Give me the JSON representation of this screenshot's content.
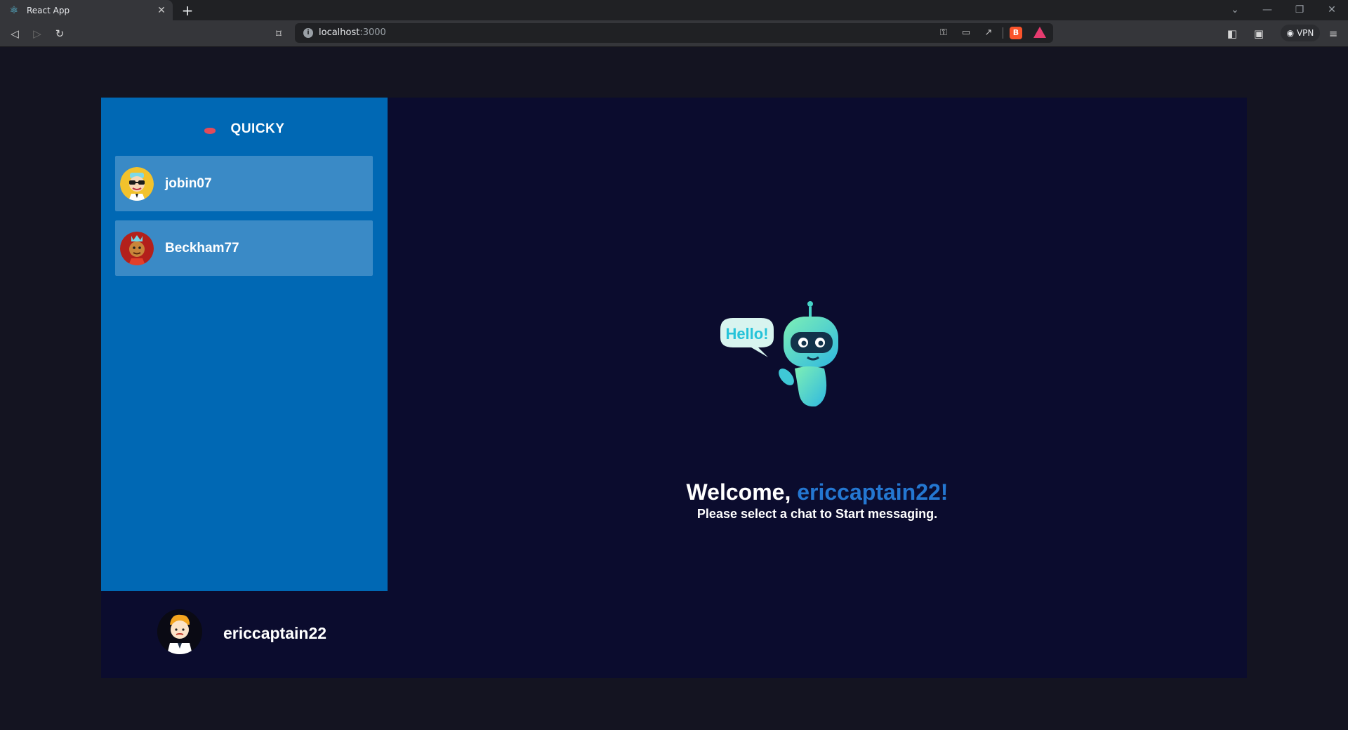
{
  "browser": {
    "tab_title": "React App",
    "url_host": "localhost",
    "url_port": ":3000",
    "vpn_label": "VPN"
  },
  "sidebar": {
    "brand": "QUICKY",
    "contacts": [
      {
        "name": "jobin07",
        "avatar": "sunglasses-avatar-icon"
      },
      {
        "name": "Beckham77",
        "avatar": "crowned-avatar-icon"
      }
    ]
  },
  "current_user": {
    "name": "ericcaptain22",
    "avatar": "man-avatar-icon"
  },
  "welcome": {
    "greeting": "Welcome, ",
    "username": "ericcaptain22!",
    "subtitle": "Please select a chat to Start messaging.",
    "bubble_text": "Hello!"
  },
  "colors": {
    "page_bg": "#141421",
    "app_bg": "#0b0c2e",
    "sidebar_bg": "#0068b4",
    "contact_bg": "#3a8ac6",
    "accent": "#2477d1"
  }
}
